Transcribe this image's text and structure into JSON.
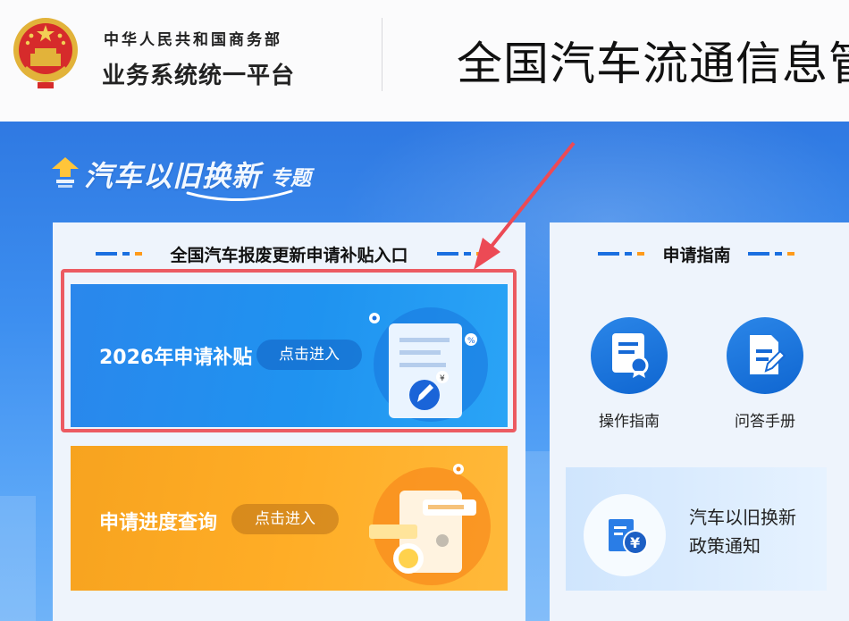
{
  "header": {
    "org_line1": "中华人民共和国商务部",
    "org_line2": "业务系统统一平台",
    "site_title": "全国汽车流通信息管"
  },
  "topic": {
    "title": "汽车以旧换新",
    "subtitle": "专题"
  },
  "left_panel": {
    "title": "全国汽车报废更新申请补贴入口",
    "apply_card": {
      "label": "2026年申请补贴",
      "button": "点击进入"
    },
    "progress_card": {
      "label": "申请进度查询",
      "button": "点击进入"
    }
  },
  "right_panel": {
    "title": "申请指南",
    "items": [
      {
        "label": "操作指南",
        "icon": "certificate-document-icon"
      },
      {
        "label": "问答手册",
        "icon": "edit-document-icon"
      }
    ],
    "notice": {
      "line1": "汽车以旧换新",
      "line2": "政策通知",
      "icon": "yen-document-icon"
    }
  },
  "colors": {
    "band_blue": "#2f79e2",
    "card_blue": "#1f93f0",
    "card_orange": "#ffad26",
    "highlight_red": "#ec5b62",
    "arrow_red": "#ec4a55"
  }
}
